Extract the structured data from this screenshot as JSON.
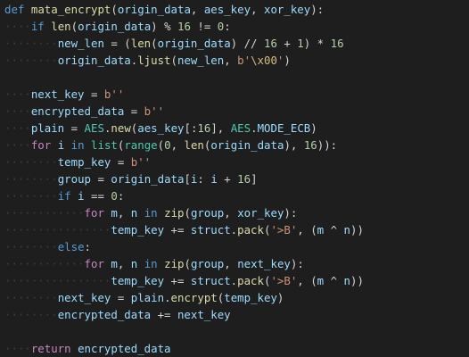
{
  "editor": {
    "background": "#1e1e1e",
    "theme_colors": {
      "keyword": "#569cd6",
      "function": "#dcdcaa",
      "variable": "#9cdcfe",
      "plain": "#d4d4d4",
      "number": "#b5cea8",
      "string": "#ce9178",
      "escape": "#d7ba7d",
      "class": "#4ec9b0",
      "control": "#c586c0",
      "whitespace_dots": "#3c3c3c"
    },
    "lines": [
      {
        "row": 0,
        "tokens": [
          {
            "t": "def",
            "c": "kw"
          },
          {
            "t": " ",
            "c": "pl"
          },
          {
            "t": "mata_encrypt",
            "c": "fn"
          },
          {
            "t": "(",
            "c": "pl"
          },
          {
            "t": "origin_data",
            "c": "vr"
          },
          {
            "t": ", ",
            "c": "pl"
          },
          {
            "t": "aes_key",
            "c": "vr"
          },
          {
            "t": ", ",
            "c": "pl"
          },
          {
            "t": "xor_key",
            "c": "vr"
          },
          {
            "t": "):",
            "c": "pl"
          }
        ]
      },
      {
        "row": 1,
        "tokens": [
          {
            "t": "····",
            "c": "ws"
          },
          {
            "t": "if",
            "c": "kw"
          },
          {
            "t": " ",
            "c": "pl"
          },
          {
            "t": "len",
            "c": "fn"
          },
          {
            "t": "(",
            "c": "pl"
          },
          {
            "t": "origin_data",
            "c": "vr"
          },
          {
            "t": ") % ",
            "c": "pl"
          },
          {
            "t": "16",
            "c": "nm"
          },
          {
            "t": " != ",
            "c": "pl"
          },
          {
            "t": "0",
            "c": "nm"
          },
          {
            "t": ":",
            "c": "pl"
          }
        ]
      },
      {
        "row": 2,
        "tokens": [
          {
            "t": "········",
            "c": "ws"
          },
          {
            "t": "new_len",
            "c": "vr"
          },
          {
            "t": " = (",
            "c": "pl"
          },
          {
            "t": "len",
            "c": "fn"
          },
          {
            "t": "(",
            "c": "pl"
          },
          {
            "t": "origin_data",
            "c": "vr"
          },
          {
            "t": ") // ",
            "c": "pl"
          },
          {
            "t": "16",
            "c": "nm"
          },
          {
            "t": " + ",
            "c": "pl"
          },
          {
            "t": "1",
            "c": "nm"
          },
          {
            "t": ") * ",
            "c": "pl"
          },
          {
            "t": "16",
            "c": "nm"
          }
        ]
      },
      {
        "row": 3,
        "tokens": [
          {
            "t": "········",
            "c": "ws"
          },
          {
            "t": "origin_data",
            "c": "vr"
          },
          {
            "t": ".",
            "c": "pl"
          },
          {
            "t": "ljust",
            "c": "fn"
          },
          {
            "t": "(",
            "c": "pl"
          },
          {
            "t": "new_len",
            "c": "vr"
          },
          {
            "t": ", ",
            "c": "pl"
          },
          {
            "t": "b'",
            "c": "st"
          },
          {
            "t": "\\x00",
            "c": "es"
          },
          {
            "t": "'",
            "c": "st"
          },
          {
            "t": ")",
            "c": "pl"
          }
        ]
      },
      {
        "row": 5,
        "tokens": [
          {
            "t": "····",
            "c": "ws"
          },
          {
            "t": "next_key",
            "c": "vr"
          },
          {
            "t": " = ",
            "c": "pl"
          },
          {
            "t": "b''",
            "c": "st"
          }
        ]
      },
      {
        "row": 6,
        "tokens": [
          {
            "t": "····",
            "c": "ws"
          },
          {
            "t": "encrypted_data",
            "c": "vr"
          },
          {
            "t": " = ",
            "c": "pl"
          },
          {
            "t": "b''",
            "c": "st"
          }
        ]
      },
      {
        "row": 7,
        "tokens": [
          {
            "t": "····",
            "c": "ws"
          },
          {
            "t": "plain",
            "c": "vr"
          },
          {
            "t": " = ",
            "c": "pl"
          },
          {
            "t": "AES",
            "c": "cl"
          },
          {
            "t": ".",
            "c": "pl"
          },
          {
            "t": "new",
            "c": "fn"
          },
          {
            "t": "(",
            "c": "pl"
          },
          {
            "t": "aes_key",
            "c": "vr"
          },
          {
            "t": "[:",
            "c": "pl"
          },
          {
            "t": "16",
            "c": "nm"
          },
          {
            "t": "], ",
            "c": "pl"
          },
          {
            "t": "AES",
            "c": "cl"
          },
          {
            "t": ".",
            "c": "pl"
          },
          {
            "t": "MODE_ECB",
            "c": "vr"
          },
          {
            "t": ")",
            "c": "pl"
          }
        ]
      },
      {
        "row": 8,
        "tokens": [
          {
            "t": "····",
            "c": "ws"
          },
          {
            "t": "for",
            "c": "cf"
          },
          {
            "t": " ",
            "c": "pl"
          },
          {
            "t": "i",
            "c": "vr"
          },
          {
            "t": " ",
            "c": "pl"
          },
          {
            "t": "in",
            "c": "kw"
          },
          {
            "t": " ",
            "c": "pl"
          },
          {
            "t": "list",
            "c": "cl"
          },
          {
            "t": "(",
            "c": "pl"
          },
          {
            "t": "range",
            "c": "cl"
          },
          {
            "t": "(",
            "c": "pl"
          },
          {
            "t": "0",
            "c": "nm"
          },
          {
            "t": ", ",
            "c": "pl"
          },
          {
            "t": "len",
            "c": "fn"
          },
          {
            "t": "(",
            "c": "pl"
          },
          {
            "t": "origin_data",
            "c": "vr"
          },
          {
            "t": "), ",
            "c": "pl"
          },
          {
            "t": "16",
            "c": "nm"
          },
          {
            "t": ")):",
            "c": "pl"
          }
        ]
      },
      {
        "row": 9,
        "tokens": [
          {
            "t": "········",
            "c": "ws"
          },
          {
            "t": "temp_key",
            "c": "vr"
          },
          {
            "t": " = ",
            "c": "pl"
          },
          {
            "t": "b''",
            "c": "st"
          }
        ]
      },
      {
        "row": 10,
        "tokens": [
          {
            "t": "········",
            "c": "ws"
          },
          {
            "t": "group",
            "c": "vr"
          },
          {
            "t": " = ",
            "c": "pl"
          },
          {
            "t": "origin_data",
            "c": "vr"
          },
          {
            "t": "[",
            "c": "pl"
          },
          {
            "t": "i",
            "c": "vr"
          },
          {
            "t": ": ",
            "c": "pl"
          },
          {
            "t": "i",
            "c": "vr"
          },
          {
            "t": " + ",
            "c": "pl"
          },
          {
            "t": "16",
            "c": "nm"
          },
          {
            "t": "]",
            "c": "pl"
          }
        ]
      },
      {
        "row": 11,
        "tokens": [
          {
            "t": "········",
            "c": "ws"
          },
          {
            "t": "if",
            "c": "kw"
          },
          {
            "t": " ",
            "c": "pl"
          },
          {
            "t": "i",
            "c": "vr"
          },
          {
            "t": " == ",
            "c": "pl"
          },
          {
            "t": "0",
            "c": "nm"
          },
          {
            "t": ":",
            "c": "pl"
          }
        ]
      },
      {
        "row": 12,
        "tokens": [
          {
            "t": "············",
            "c": "ws"
          },
          {
            "t": "for",
            "c": "cf"
          },
          {
            "t": " ",
            "c": "pl"
          },
          {
            "t": "m",
            "c": "vr"
          },
          {
            "t": ", ",
            "c": "pl"
          },
          {
            "t": "n",
            "c": "vr"
          },
          {
            "t": " ",
            "c": "pl"
          },
          {
            "t": "in",
            "c": "kw"
          },
          {
            "t": " ",
            "c": "pl"
          },
          {
            "t": "zip",
            "c": "fn"
          },
          {
            "t": "(",
            "c": "pl"
          },
          {
            "t": "group",
            "c": "vr"
          },
          {
            "t": ", ",
            "c": "pl"
          },
          {
            "t": "xor_key",
            "c": "vr"
          },
          {
            "t": "):",
            "c": "pl"
          }
        ]
      },
      {
        "row": 13,
        "tokens": [
          {
            "t": "················",
            "c": "ws"
          },
          {
            "t": "temp_key",
            "c": "vr"
          },
          {
            "t": " += ",
            "c": "pl"
          },
          {
            "t": "struct",
            "c": "vr"
          },
          {
            "t": ".",
            "c": "pl"
          },
          {
            "t": "pack",
            "c": "fn"
          },
          {
            "t": "(",
            "c": "pl"
          },
          {
            "t": "'>B'",
            "c": "st"
          },
          {
            "t": ", (",
            "c": "pl"
          },
          {
            "t": "m",
            "c": "vr"
          },
          {
            "t": " ^ ",
            "c": "pl"
          },
          {
            "t": "n",
            "c": "vr"
          },
          {
            "t": "))",
            "c": "pl"
          }
        ]
      },
      {
        "row": 14,
        "tokens": [
          {
            "t": "········",
            "c": "ws"
          },
          {
            "t": "else",
            "c": "kw"
          },
          {
            "t": ":",
            "c": "pl"
          }
        ]
      },
      {
        "row": 15,
        "tokens": [
          {
            "t": "············",
            "c": "ws"
          },
          {
            "t": "for",
            "c": "cf"
          },
          {
            "t": " ",
            "c": "pl"
          },
          {
            "t": "m",
            "c": "vr"
          },
          {
            "t": ", ",
            "c": "pl"
          },
          {
            "t": "n",
            "c": "vr"
          },
          {
            "t": " ",
            "c": "pl"
          },
          {
            "t": "in",
            "c": "kw"
          },
          {
            "t": " ",
            "c": "pl"
          },
          {
            "t": "zip",
            "c": "fn"
          },
          {
            "t": "(",
            "c": "pl"
          },
          {
            "t": "group",
            "c": "vr"
          },
          {
            "t": ", ",
            "c": "pl"
          },
          {
            "t": "next_key",
            "c": "vr"
          },
          {
            "t": "):",
            "c": "pl"
          }
        ]
      },
      {
        "row": 16,
        "tokens": [
          {
            "t": "················",
            "c": "ws"
          },
          {
            "t": "temp_key",
            "c": "vr"
          },
          {
            "t": " += ",
            "c": "pl"
          },
          {
            "t": "struct",
            "c": "vr"
          },
          {
            "t": ".",
            "c": "pl"
          },
          {
            "t": "pack",
            "c": "fn"
          },
          {
            "t": "(",
            "c": "pl"
          },
          {
            "t": "'>B'",
            "c": "st"
          },
          {
            "t": ", (",
            "c": "pl"
          },
          {
            "t": "m",
            "c": "vr"
          },
          {
            "t": " ^ ",
            "c": "pl"
          },
          {
            "t": "n",
            "c": "vr"
          },
          {
            "t": "))",
            "c": "pl"
          }
        ]
      },
      {
        "row": 17,
        "tokens": [
          {
            "t": "········",
            "c": "ws"
          },
          {
            "t": "next_key",
            "c": "vr"
          },
          {
            "t": " = ",
            "c": "pl"
          },
          {
            "t": "plain",
            "c": "vr"
          },
          {
            "t": ".",
            "c": "pl"
          },
          {
            "t": "encrypt",
            "c": "fn"
          },
          {
            "t": "(",
            "c": "pl"
          },
          {
            "t": "temp_key",
            "c": "vr"
          },
          {
            "t": ")",
            "c": "pl"
          }
        ]
      },
      {
        "row": 18,
        "tokens": [
          {
            "t": "········",
            "c": "ws"
          },
          {
            "t": "encrypted_data",
            "c": "vr"
          },
          {
            "t": " += ",
            "c": "pl"
          },
          {
            "t": "next_key",
            "c": "vr"
          }
        ]
      },
      {
        "row": 20,
        "tokens": [
          {
            "t": "····",
            "c": "ws"
          },
          {
            "t": "return",
            "c": "cf"
          },
          {
            "t": " ",
            "c": "pl"
          },
          {
            "t": "encrypted_data",
            "c": "vr"
          }
        ]
      }
    ]
  }
}
